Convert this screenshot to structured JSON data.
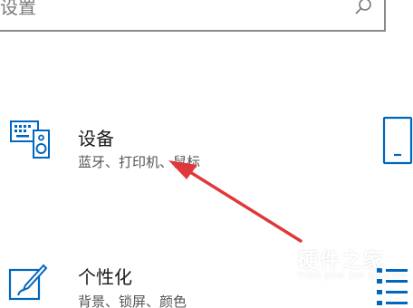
{
  "search": {
    "value": "设置"
  },
  "tiles": [
    {
      "title": "设备",
      "description": "蓝牙、打印机、鼠标",
      "icon": "keyboard-speaker-icon"
    },
    {
      "title": "个性化",
      "description": "背景、锁屏、颜色",
      "icon": "paint-brush-icon"
    }
  ],
  "right_tiles": [
    {
      "icon": "phone-icon"
    },
    {
      "icon": "apps-list-icon"
    }
  ],
  "watermark": {
    "title": "硬件之家",
    "subtitle": "YING JIAN ZHI JIA.COM"
  },
  "colors": {
    "accent": "#0067c0",
    "arrow": "#e0383a"
  }
}
